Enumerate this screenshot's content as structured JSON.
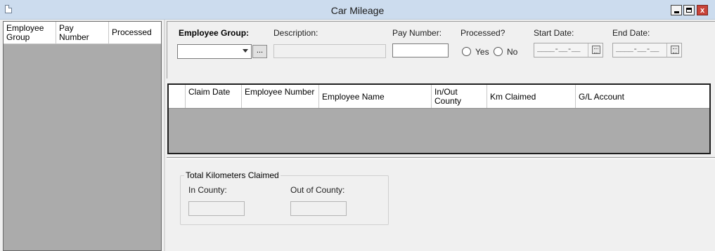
{
  "window": {
    "title": "Car Mileage",
    "close_glyph": "x"
  },
  "left_grid": {
    "columns": [
      "Employee Group",
      "Pay Number",
      "Processed"
    ]
  },
  "filters": {
    "employee_group_label": "Employee Group:",
    "employee_group_value": "",
    "browse_label": "...",
    "description_label": "Description:",
    "description_value": "",
    "pay_number_label": "Pay Number:",
    "pay_number_value": "",
    "processed_label": "Processed?",
    "yes_label": "Yes",
    "no_label": "No",
    "start_date_label": "Start Date:",
    "start_date_value": "____-__-__",
    "end_date_label": "End Date:",
    "end_date_value": "____-__-__"
  },
  "claims_grid": {
    "columns": [
      "",
      "Claim Date",
      "Employee Number",
      "Employee Name",
      "In/Out County",
      "Km Claimed",
      "G/L Account"
    ]
  },
  "totals": {
    "group_title": "Total Kilometers Claimed",
    "in_county_label": "In County:",
    "in_county_value": "",
    "out_county_label": "Out of County:",
    "out_county_value": ""
  }
}
